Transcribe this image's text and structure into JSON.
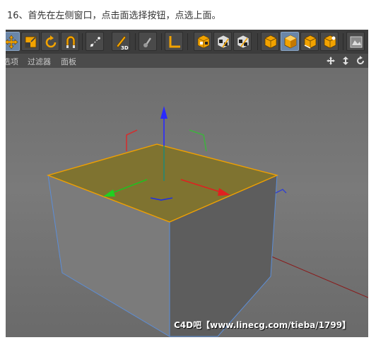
{
  "caption": "16、首先在左侧窗口，点击面选择按钮，点选上面。",
  "menu": {
    "items": [
      "选项",
      "过滤器",
      "面板"
    ]
  },
  "watermark": "C4D吧【www.linecg.com/tieba/1799】",
  "colors": {
    "toolbar_bg": "#3c3c3c",
    "menubar_bg": "#4b4b4b",
    "viewport_bg": "#747474",
    "selected_face": "#7f7330",
    "selection_edge": "#f0a000",
    "wire_edge": "#5c8ed8",
    "axis_x": "#e02020",
    "axis_y": "#20c020",
    "axis_z": "#2030e0",
    "accent_orange": "#f2a300"
  },
  "toolbar": {
    "buttons": [
      {
        "name": "move-tool-icon",
        "active": true
      },
      {
        "name": "scale-tool-icon"
      },
      {
        "name": "rotate-tool-icon"
      },
      {
        "name": "magnet-tool-icon"
      },
      {
        "name": "live-selection-icon"
      },
      {
        "name": "brush-3d-icon"
      },
      {
        "name": "sculpt-brush-icon"
      },
      {
        "name": "workplane-icon"
      },
      {
        "name": "checker-model-icon"
      },
      {
        "name": "checker-texture-icon"
      },
      {
        "name": "checker-axis-icon"
      },
      {
        "name": "points-mode-icon"
      },
      {
        "name": "polygons-mode-icon",
        "active": true
      },
      {
        "name": "edges-mode-icon"
      },
      {
        "name": "uvw-mode-icon"
      },
      {
        "name": "render-view-icon"
      }
    ]
  }
}
